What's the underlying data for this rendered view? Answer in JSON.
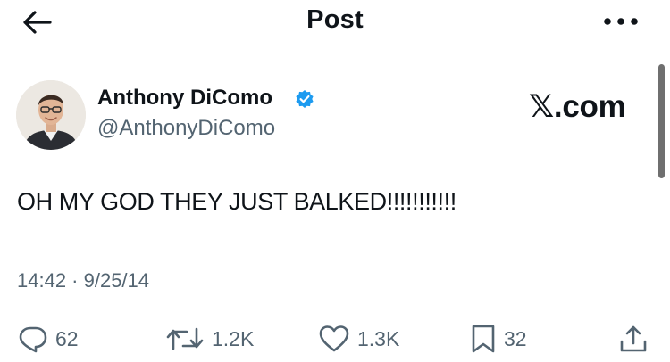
{
  "header": {
    "title": "Post",
    "back_icon": "arrow-left-icon",
    "more_icon": "more-horizontal-icon"
  },
  "author": {
    "name": "Anthony DiComo",
    "handle": "@AnthonyDiComo",
    "verified": true,
    "verified_color": "#1d9bf0"
  },
  "watermark": "𝕏.com",
  "tweet": {
    "text": "OH MY GOD THEY JUST BALKED!!!!!!!!!!!",
    "timestamp": "14:42 · 9/25/14"
  },
  "actions": {
    "replies": "62",
    "reposts": "1.2K",
    "likes": "1.3K",
    "bookmarks": "32"
  },
  "colors": {
    "text": "#0f1419",
    "secondary": "#536471",
    "accent": "#1d9bf0"
  }
}
